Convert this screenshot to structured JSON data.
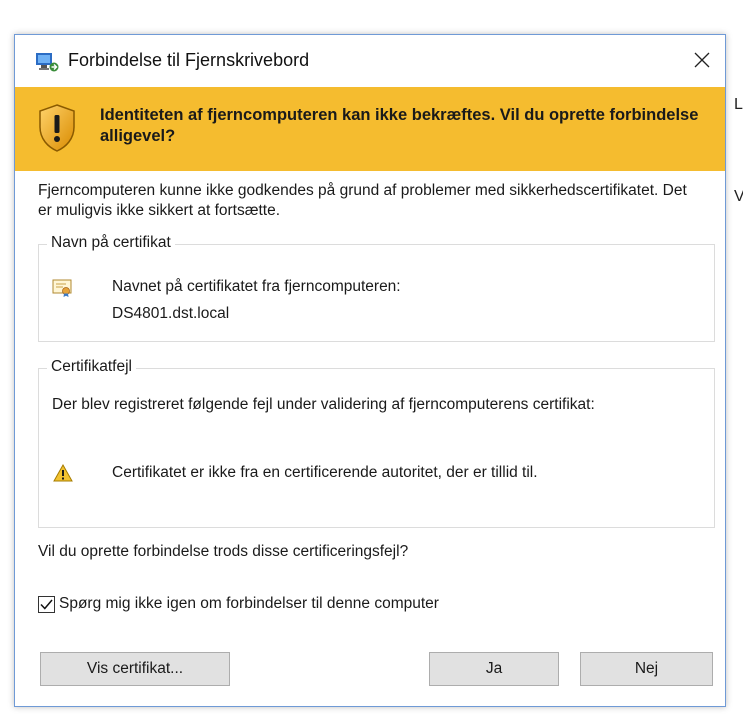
{
  "background": {
    "side_text_1": "L",
    "side_text_2": "V"
  },
  "dialog": {
    "title": "Forbindelse til Fjernskrivebord",
    "close_glyph": "✕",
    "banner": {
      "text": "Identiteten af fjerncomputeren kan ikke bekræftes. Vil du oprette forbindelse alligevel?",
      "color": "#f5bc2f"
    },
    "intro": "Fjerncomputeren kunne ikke godkendes på grund af problemer med sikkerhedscertifikatet. Det er muligvis ikke sikkert at fortsætte.",
    "cert_name_group": {
      "legend": "Navn på certifikat",
      "icon": "certificate-icon",
      "label": "Navnet på certifikatet fra fjerncomputeren:",
      "value": "DS4801.dst.local"
    },
    "cert_error_group": {
      "legend": "Certifikatfejl",
      "description": "Der blev registreret følgende fejl under validering af fjerncomputerens certifikat:",
      "icon": "warning-icon",
      "error": "Certifikatet er ikke fra en certificerende autoritet, der er tillid til."
    },
    "question": "Vil du oprette forbindelse trods disse certificeringsfejl?",
    "checkbox": {
      "label": "Spørg mig ikke igen om forbindelser til denne computer",
      "checked": true
    },
    "buttons": {
      "view_cert": "Vis certifikat...",
      "yes": "Ja",
      "no": "Nej"
    }
  }
}
